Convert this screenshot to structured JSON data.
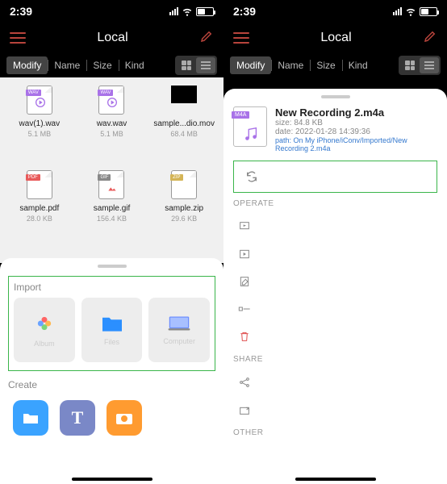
{
  "status": {
    "time": "2:39"
  },
  "nav": {
    "title": "Local"
  },
  "sort": {
    "modify": "Modify",
    "name": "Name",
    "size": "Size",
    "kind": "Kind"
  },
  "files": [
    {
      "name": "wav(1).wav",
      "size": "5.1 MB",
      "type": "wav",
      "badge": "WAV"
    },
    {
      "name": "wav.wav",
      "size": "5.1 MB",
      "type": "wav",
      "badge": "WAV"
    },
    {
      "name": "sample...dio.mov",
      "size": "68.4 MB",
      "type": "mov"
    },
    {
      "name": "sample.pdf",
      "size": "28.0 KB",
      "type": "pdf",
      "badge": "PDF"
    },
    {
      "name": "sample.gif",
      "size": "156.4 KB",
      "type": "gif",
      "badge": "GIF"
    },
    {
      "name": "sample.zip",
      "size": "29.6 KB",
      "type": "zip",
      "badge": "ZIP"
    }
  ],
  "sheet_left": {
    "import_label": "Import",
    "import_items": [
      {
        "label": "Album",
        "icon": "photos"
      },
      {
        "label": "Files",
        "icon": "folder"
      },
      {
        "label": "Computer",
        "icon": "computer"
      }
    ],
    "create_label": "Create",
    "create_items": [
      {
        "icon": "folder-new",
        "color": "#3aa3ff"
      },
      {
        "icon": "text",
        "color": "#7a88c7"
      },
      {
        "icon": "camera",
        "color": "#ff9b30"
      }
    ]
  },
  "detail": {
    "badge": "M4A",
    "title": "New Recording 2.m4a",
    "size_label": "size: 84.8 KB",
    "date_label": "date: 2022-01-28 14:39:36",
    "path_label": "path: On My iPhone/iConv/Imported/New Recording 2.m4a",
    "sections": {
      "operate": "OPERATE",
      "share": "SHARE",
      "other": "OTHER"
    }
  },
  "colors": {
    "accent_red": "#b8443c",
    "highlight_green": "#3ab54a",
    "link_blue": "#3478ce",
    "purple": "#a972e8"
  }
}
